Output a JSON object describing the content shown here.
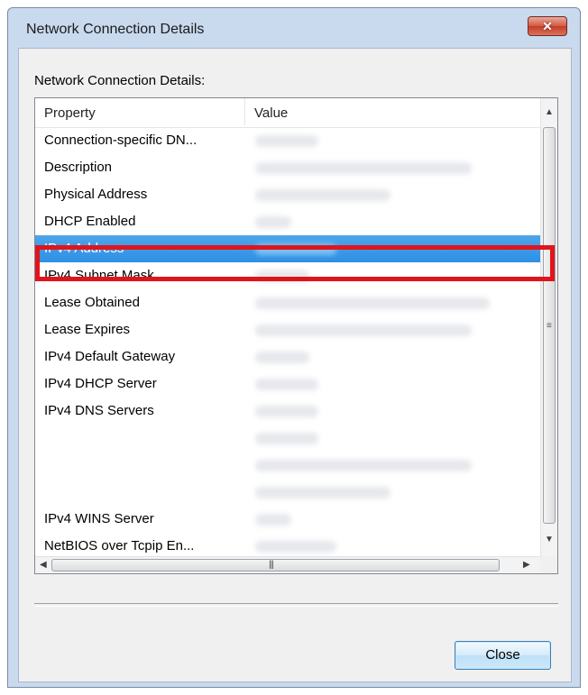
{
  "window": {
    "title": "Network Connection Details",
    "close_glyph": "✕"
  },
  "dialog": {
    "group_label": "Network Connection Details:",
    "columns": [
      "Property",
      "Value"
    ],
    "rows": [
      {
        "property": "Connection-specific DN...",
        "selected": false
      },
      {
        "property": "Description",
        "selected": false
      },
      {
        "property": "Physical Address",
        "selected": false
      },
      {
        "property": "DHCP Enabled",
        "selected": false
      },
      {
        "property": "IPv4 Address",
        "selected": true
      },
      {
        "property": "IPv4 Subnet Mask",
        "selected": false
      },
      {
        "property": "Lease Obtained",
        "selected": false
      },
      {
        "property": "Lease Expires",
        "selected": false
      },
      {
        "property": "IPv4 Default Gateway",
        "selected": false
      },
      {
        "property": "IPv4 DHCP Server",
        "selected": false
      },
      {
        "property": "IPv4 DNS Servers",
        "selected": false
      },
      {
        "property": "",
        "selected": false
      },
      {
        "property": "",
        "selected": false
      },
      {
        "property": "",
        "selected": false
      },
      {
        "property": "IPv4 WINS Server",
        "selected": false
      },
      {
        "property": "NetBIOS over Tcpip En...",
        "selected": false
      }
    ],
    "value_placeholder": "blurred",
    "close_button": "Close"
  },
  "icons": {
    "scroll_up": "▲",
    "scroll_down": "▼",
    "scroll_left": "◀",
    "scroll_right": "▶",
    "vgrip": "≡",
    "hgrip": "|||"
  },
  "colors": {
    "highlight_box": "#e2141b",
    "selection": "#3399ff"
  }
}
